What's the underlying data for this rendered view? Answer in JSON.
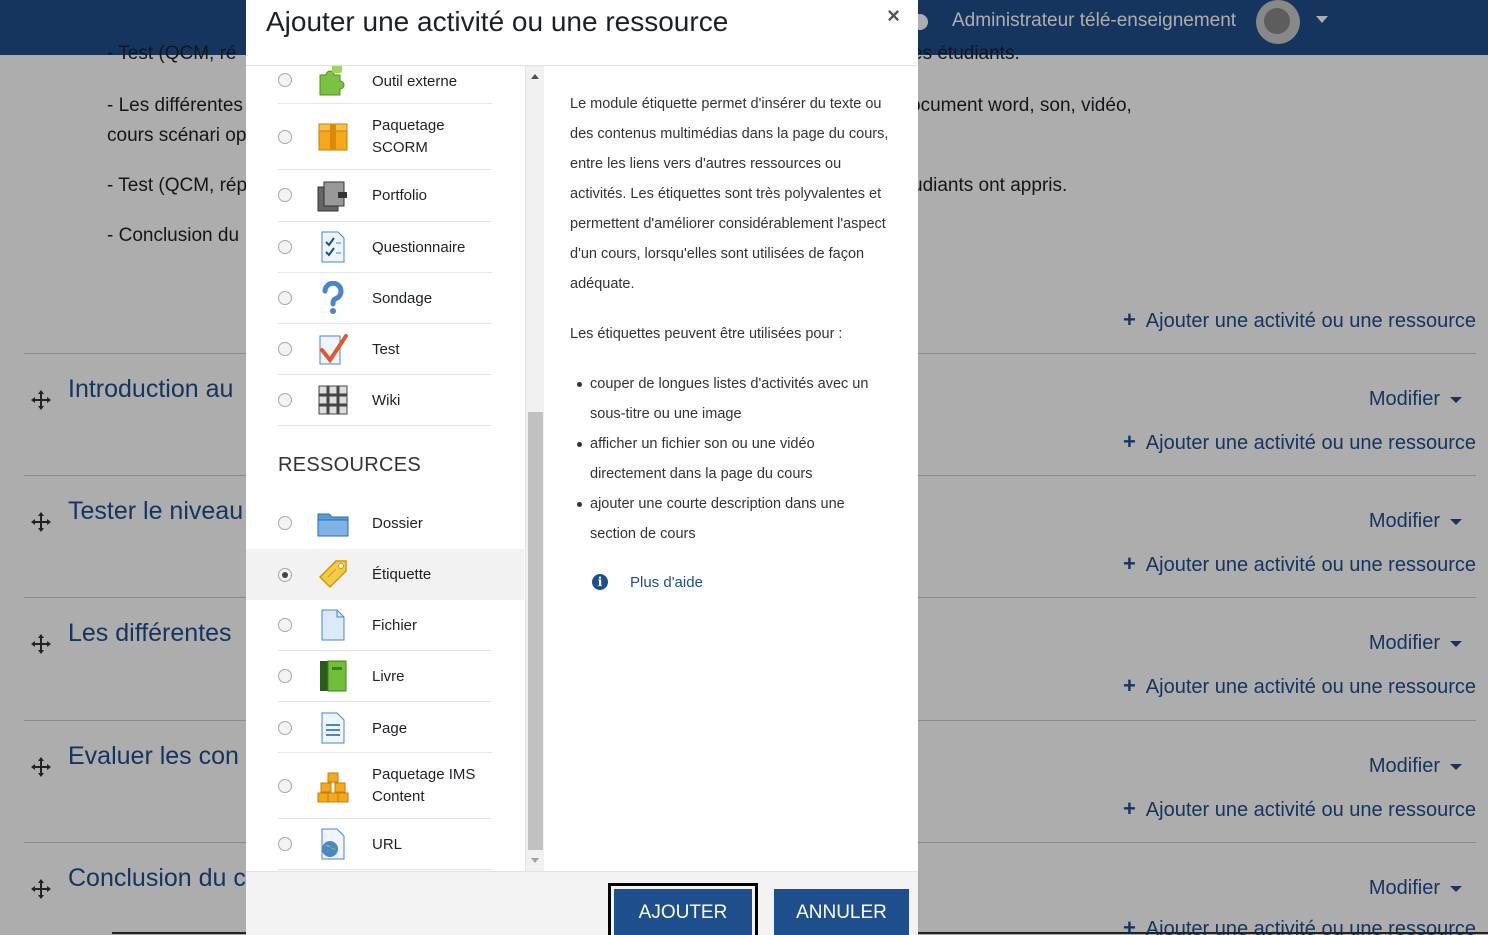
{
  "navbar": {
    "user_name": "Administrateur télé-enseignement"
  },
  "page": {
    "lines": [
      "- Test (QCM, ré",
      "es étudiants.",
      "- Les différentes",
      "ocument word, son, vidéo,",
      "cours scénari op",
      "- Test (QCM, rép",
      "udiants ont appris.",
      "- Conclusion du"
    ],
    "add_label": "Ajouter une activité ou une ressource",
    "modify_label": "Modifier",
    "sections": [
      "Introduction au",
      "Tester le niveau",
      "Les différentes",
      "Evaluer les con",
      "Conclusion du c"
    ]
  },
  "modal": {
    "title": "Ajouter une activité ou une ressource",
    "close": "×",
    "group_resources": "RESSOURCES",
    "activities": [
      {
        "label": "Outil externe",
        "icon": "puzzle-icon"
      },
      {
        "label": "Paquetage SCORM",
        "icon": "package-icon"
      },
      {
        "label": "Portfolio",
        "icon": "portfolio-icon"
      },
      {
        "label": "Questionnaire",
        "icon": "questionnaire-icon"
      },
      {
        "label": "Sondage",
        "icon": "question-mark-icon"
      },
      {
        "label": "Test",
        "icon": "checkmark-icon"
      },
      {
        "label": "Wiki",
        "icon": "wiki-icon"
      }
    ],
    "resources": [
      {
        "label": "Dossier",
        "icon": "folder-icon"
      },
      {
        "label": "Étiquette",
        "icon": "label-tag-icon",
        "selected": true
      },
      {
        "label": "Fichier",
        "icon": "file-icon"
      },
      {
        "label": "Livre",
        "icon": "book-icon"
      },
      {
        "label": "Page",
        "icon": "page-icon"
      },
      {
        "label": "Paquetage IMS Content",
        "icon": "ims-package-icon"
      },
      {
        "label": "URL",
        "icon": "url-globe-icon"
      }
    ],
    "help": {
      "p1": "Le module étiquette permet d'insérer du texte ou des contenus multimédias dans la page du cours, entre les liens vers d'autres ressources ou activités. Les étiquettes sont très polyvalentes et permettent d'améliorer considérablement l'aspect d'un cours, lorsqu'elles sont utilisées de façon adéquate.",
      "p2": "Les étiquettes peuvent être utilisées pour :",
      "items": [
        "couper de longues listes d'activités avec un sous-titre ou une image",
        "afficher un fichier son ou une vidéo directement dans la page du cours",
        "ajouter une courte description dans une section de cours"
      ],
      "more_help": "Plus d'aide"
    },
    "buttons": {
      "add": "AJOUTER",
      "cancel": "ANNULER"
    }
  },
  "colors": {
    "navbar": "#1f4e8c",
    "link": "#1f4e8c",
    "button": "#1f4e8c"
  }
}
